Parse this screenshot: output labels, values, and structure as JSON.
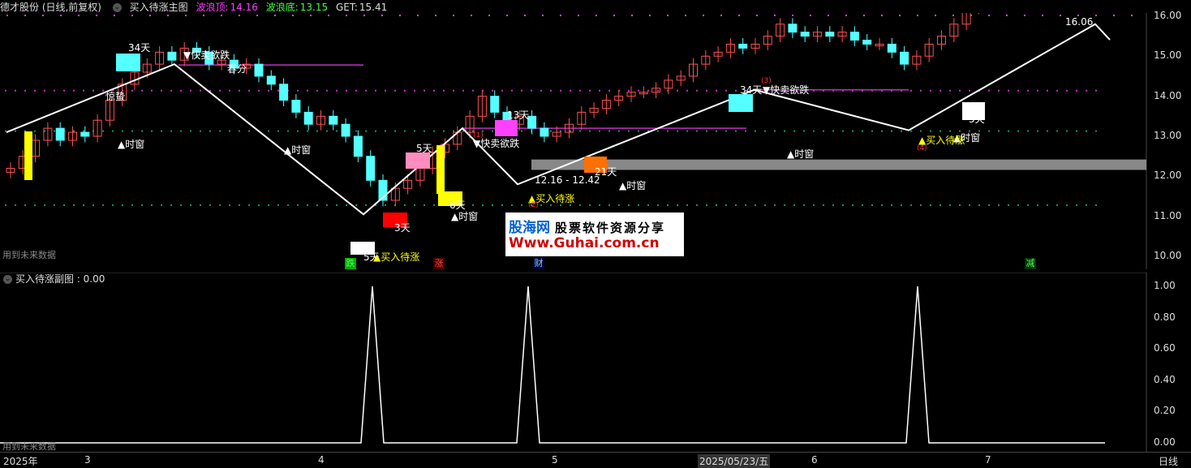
{
  "header": {
    "stock": "德才股份 (日线,前复权)",
    "indicator": "买入待涨主图",
    "wave_top_label": "波浪顶:",
    "wave_top_value": "14.16",
    "wave_bottom_label": "波浪底:",
    "wave_bottom_value": "13.15",
    "get_label": "GET:",
    "get_value": "15.41",
    "colors": {
      "top": "#ff3cff",
      "bottom": "#3cff3c",
      "get": "#ffffff"
    }
  },
  "sub_header": {
    "title": "买入待涨副图 : 0.00"
  },
  "notes": {
    "future_main": "用到未来数据",
    "future_sub": "用到未来数据"
  },
  "watermark": {
    "line1_blue": "股海网",
    "line1_rest": "股票软件资源分享",
    "line2": "Www.Guhai.com.cn"
  },
  "y_axis_main": [
    "16.00",
    "15.00",
    "14.00",
    "13.00",
    "12.00",
    "11.00",
    "10.00"
  ],
  "y_axis_sub": [
    "1.00",
    "0.80",
    "0.60",
    "0.40",
    "0.20",
    "0.00"
  ],
  "x_axis": [
    "2025年",
    "3",
    "4",
    "5",
    "2025/05/23/五",
    "6",
    "7"
  ],
  "period_label": "日线",
  "price_labels": {
    "high": "16.06",
    "range": "12.16 - 12.42"
  },
  "annotations": {
    "days": [
      "34天",
      "5天",
      "3天",
      "13天",
      "6天",
      "21天",
      "34天",
      "5天",
      "5天"
    ],
    "shi_chuang": "▲时窗",
    "kuai_mai": "▼快卖欲跌",
    "mai_ru": "▲买入待涨",
    "chun_fen": "春分",
    "jing_zhe": "惊蛰",
    "circles": [
      "(1)",
      "(2)",
      "(3)",
      "(4)"
    ],
    "bottom_tags": [
      "跌",
      "涨",
      "财",
      "减"
    ]
  },
  "chart_data": {
    "type": "line",
    "main_price_range": [
      9.8,
      16.2
    ],
    "series": [
      {
        "values": [
          12.15,
          12.4,
          12.95,
          13.4,
          13.8,
          14.2,
          14.6,
          14.8,
          14.0,
          13.3,
          12.5,
          11.7,
          11.05,
          11.6,
          12.2,
          12.7,
          13.2,
          12.5,
          11.8,
          12.2,
          12.6,
          12.9,
          13.1,
          13.4,
          13.75,
          14.16,
          13.9,
          13.6,
          13.4,
          13.15,
          13.6,
          14.2,
          14.8,
          15.3,
          15.8,
          16.06
        ]
      },
      {
        "values": [
          0,
          0,
          0,
          1,
          0,
          0,
          0,
          0,
          1,
          0,
          0,
          0,
          0,
          0,
          0,
          0,
          1,
          0,
          0
        ]
      }
    ],
    "wave_top": 14.16,
    "wave_bottom": 13.15,
    "get": 15.41,
    "sub_ylim": [
      0,
      1
    ]
  }
}
